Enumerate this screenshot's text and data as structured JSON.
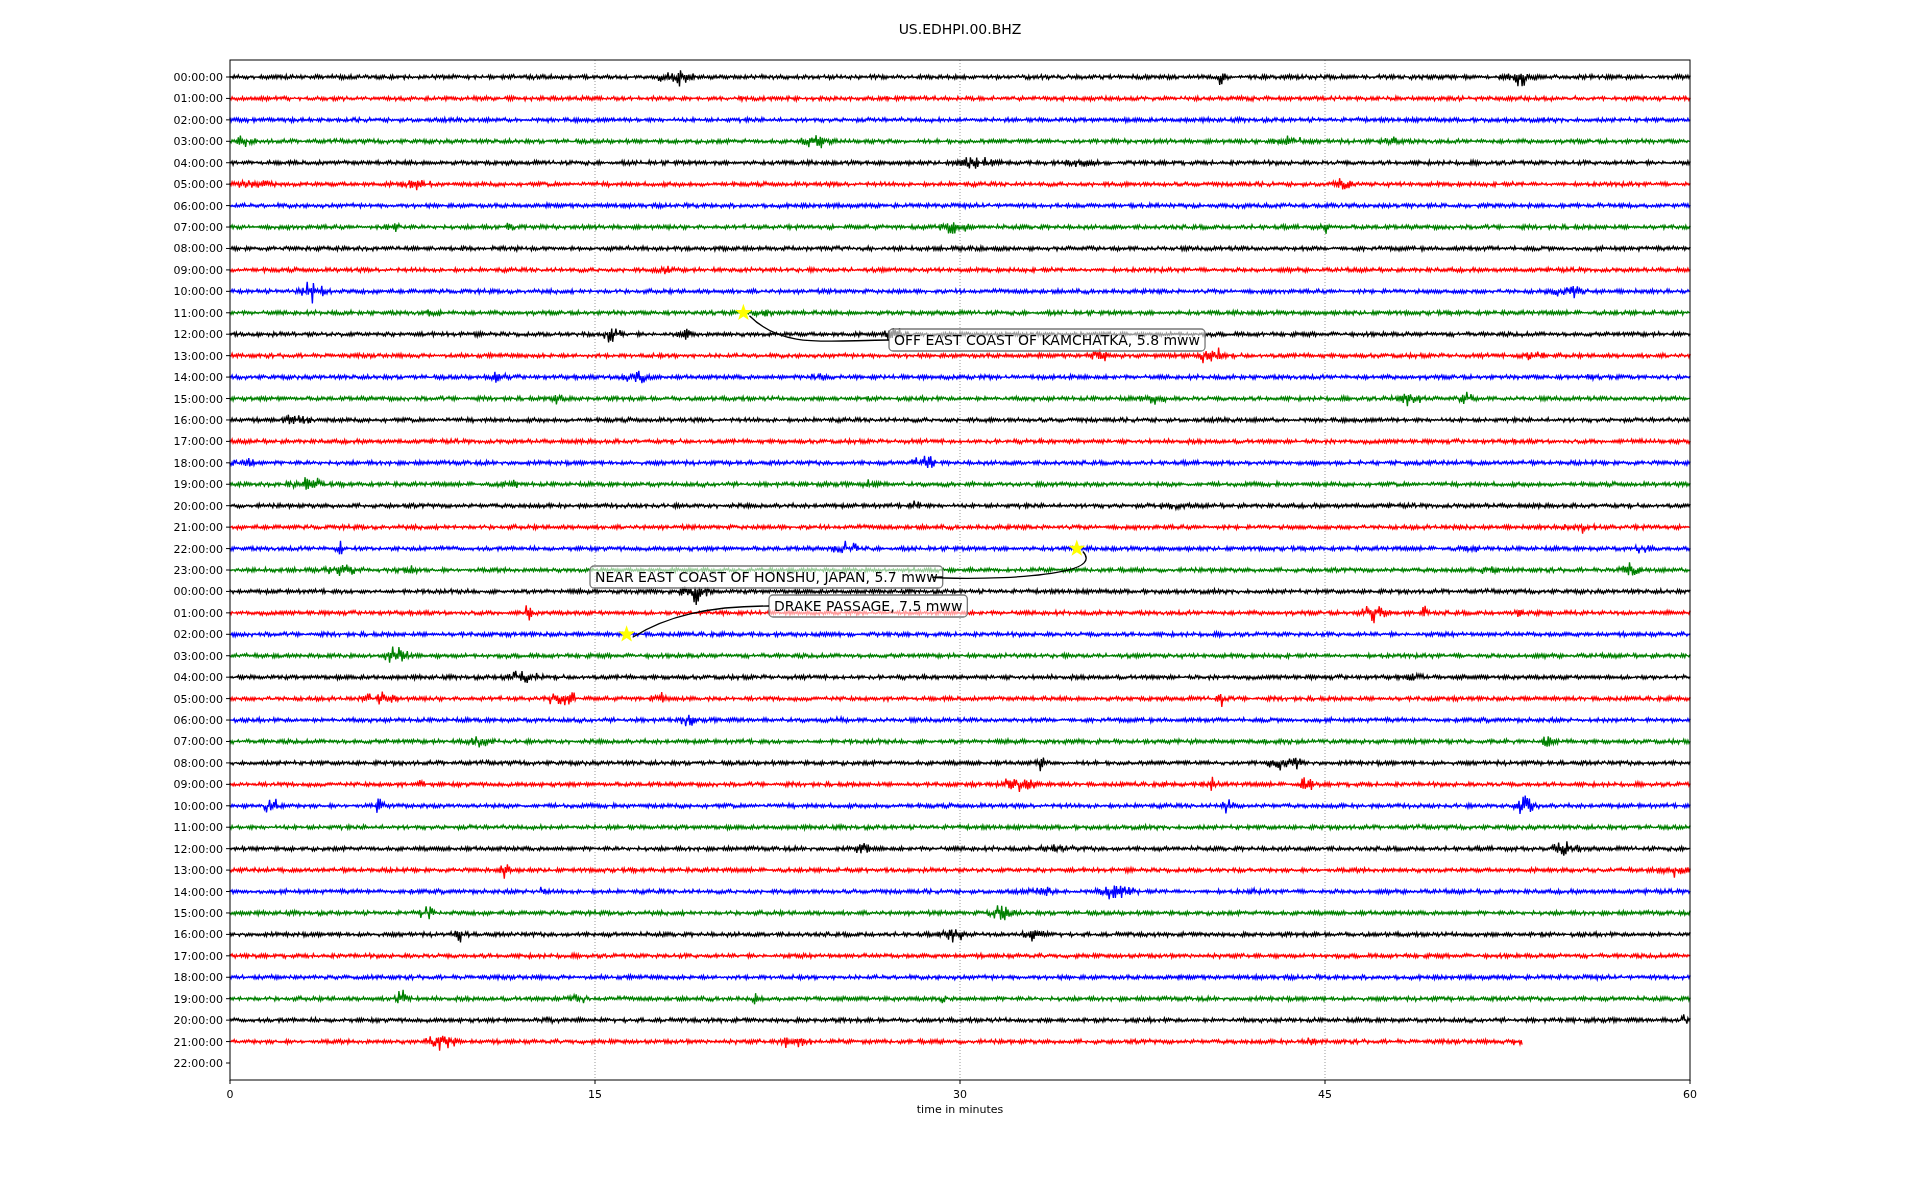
{
  "title": "US.EDHPI.00.BHZ",
  "xlabel": "time in minutes",
  "xticks": [
    "0",
    "15",
    "30",
    "45",
    "60"
  ],
  "rows": [
    {
      "label": "00:00:00",
      "kind": "full",
      "color": "#000000"
    },
    {
      "label": "01:00:00",
      "kind": "full",
      "color": "#ff0000"
    },
    {
      "label": "02:00:00",
      "kind": "full",
      "color": "#0000ff"
    },
    {
      "label": "03:00:00",
      "kind": "full",
      "color": "#008000"
    },
    {
      "label": "04:00:00",
      "kind": "full",
      "color": "#000000"
    },
    {
      "label": "05:00:00",
      "kind": "full",
      "color": "#ff0000"
    },
    {
      "label": "06:00:00",
      "kind": "full",
      "color": "#0000ff"
    },
    {
      "label": "07:00:00",
      "kind": "full",
      "color": "#008000"
    },
    {
      "label": "08:00:00",
      "kind": "full",
      "color": "#000000"
    },
    {
      "label": "09:00:00",
      "kind": "full",
      "color": "#ff0000"
    },
    {
      "label": "10:00:00",
      "kind": "full",
      "color": "#0000ff"
    },
    {
      "label": "11:00:00",
      "kind": "full",
      "color": "#008000"
    },
    {
      "label": "12:00:00",
      "kind": "full",
      "color": "#000000"
    },
    {
      "label": "13:00:00",
      "kind": "full",
      "color": "#ff0000"
    },
    {
      "label": "14:00:00",
      "kind": "full",
      "color": "#0000ff"
    },
    {
      "label": "15:00:00",
      "kind": "full",
      "color": "#008000"
    },
    {
      "label": "16:00:00",
      "kind": "full",
      "color": "#000000"
    },
    {
      "label": "17:00:00",
      "kind": "full",
      "color": "#ff0000"
    },
    {
      "label": "18:00:00",
      "kind": "full",
      "color": "#0000ff"
    },
    {
      "label": "19:00:00",
      "kind": "full",
      "color": "#008000"
    },
    {
      "label": "20:00:00",
      "kind": "full",
      "color": "#000000"
    },
    {
      "label": "21:00:00",
      "kind": "full",
      "color": "#ff0000"
    },
    {
      "label": "22:00:00",
      "kind": "full",
      "color": "#0000ff"
    },
    {
      "label": "23:00:00",
      "kind": "full",
      "color": "#008000"
    },
    {
      "label": "00:00:00",
      "kind": "full",
      "color": "#000000"
    },
    {
      "label": "01:00:00",
      "kind": "full",
      "color": "#ff0000"
    },
    {
      "label": "02:00:00",
      "kind": "full",
      "color": "#0000ff"
    },
    {
      "label": "03:00:00",
      "kind": "full",
      "color": "#008000"
    },
    {
      "label": "04:00:00",
      "kind": "full",
      "color": "#000000"
    },
    {
      "label": "05:00:00",
      "kind": "full",
      "color": "#ff0000"
    },
    {
      "label": "06:00:00",
      "kind": "full",
      "color": "#0000ff"
    },
    {
      "label": "07:00:00",
      "kind": "full",
      "color": "#008000"
    },
    {
      "label": "08:00:00",
      "kind": "full",
      "color": "#000000"
    },
    {
      "label": "09:00:00",
      "kind": "full",
      "color": "#ff0000"
    },
    {
      "label": "10:00:00",
      "kind": "full",
      "color": "#0000ff"
    },
    {
      "label": "11:00:00",
      "kind": "full",
      "color": "#008000"
    },
    {
      "label": "12:00:00",
      "kind": "full",
      "color": "#000000"
    },
    {
      "label": "13:00:00",
      "kind": "full",
      "color": "#ff0000"
    },
    {
      "label": "14:00:00",
      "kind": "full",
      "color": "#0000ff"
    },
    {
      "label": "15:00:00",
      "kind": "full",
      "color": "#008000"
    },
    {
      "label": "16:00:00",
      "kind": "full",
      "color": "#000000"
    },
    {
      "label": "17:00:00",
      "kind": "full",
      "color": "#ff0000"
    },
    {
      "label": "18:00:00",
      "kind": "full",
      "color": "#0000ff"
    },
    {
      "label": "19:00:00",
      "kind": "full",
      "color": "#008000"
    },
    {
      "label": "20:00:00",
      "kind": "full",
      "color": "#000000"
    },
    {
      "label": "21:00:00",
      "kind": "partial",
      "color": "#ff0000"
    },
    {
      "label": "22:00:00",
      "kind": "empty"
    }
  ],
  "events": [
    {
      "label": "OFF EAST COAST OF KAMCHATKA, 5.8 mww"
    },
    {
      "label": "NEAR EAST COAST OF HONSHU, JAPAN, 5.7 mww"
    },
    {
      "label": "DRAKE PASSAGE, 7.5 mww"
    }
  ]
}
